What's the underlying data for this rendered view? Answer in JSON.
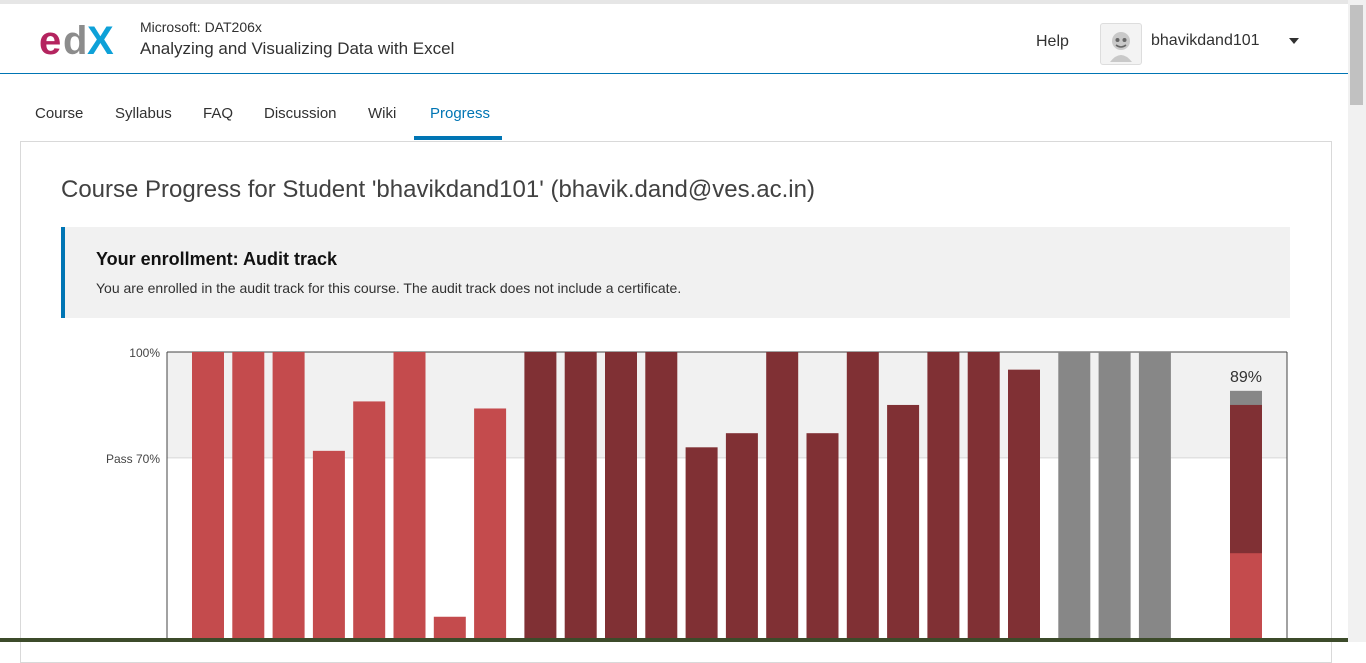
{
  "header": {
    "course_org": "Microsoft: DAT206x",
    "course_name": "Analyzing and Visualizing Data with Excel",
    "help_label": "Help",
    "username": "bhavikdand101",
    "logo_text": "edX"
  },
  "tabs": [
    {
      "label": "Course",
      "active": false
    },
    {
      "label": "Syllabus",
      "active": false
    },
    {
      "label": "FAQ",
      "active": false
    },
    {
      "label": "Discussion",
      "active": false
    },
    {
      "label": "Wiki",
      "active": false
    },
    {
      "label": "Progress",
      "active": true
    }
  ],
  "page": {
    "title": "Course Progress for Student 'bhavikdand101' (bhavik.dand@ves.ac.in)"
  },
  "enrollment": {
    "title": "Your enrollment: Audit track",
    "message": "You are enrolled in the audit track for this course. The audit track does not include a certificate."
  },
  "colors": {
    "brand_blue": "#0075b4",
    "bar_light_red": "#c44b4d",
    "bar_dark_red": "#803034",
    "bar_gray": "#878787"
  },
  "chart_data": {
    "type": "bar",
    "ytick_labels": [
      "100%",
      "Pass 70%"
    ],
    "pass_threshold": 70,
    "ylim": [
      0,
      100
    ],
    "series": [
      {
        "values": [
          100,
          100,
          100,
          72,
          86,
          100,
          25,
          84
        ],
        "color": "#c44b4d"
      },
      {
        "values": [
          100,
          100,
          100,
          100,
          73,
          77,
          100,
          77,
          100,
          85,
          100,
          100,
          95
        ],
        "color": "#803034"
      },
      {
        "values": [
          100,
          100,
          100
        ],
        "color": "#878787"
      }
    ],
    "total": {
      "label": "89%",
      "value": 89,
      "segments": [
        {
          "value": 43,
          "color": "#c44b4d"
        },
        {
          "value": 85,
          "color": "#803034"
        },
        {
          "value": 89,
          "color": "#878787"
        }
      ]
    }
  }
}
